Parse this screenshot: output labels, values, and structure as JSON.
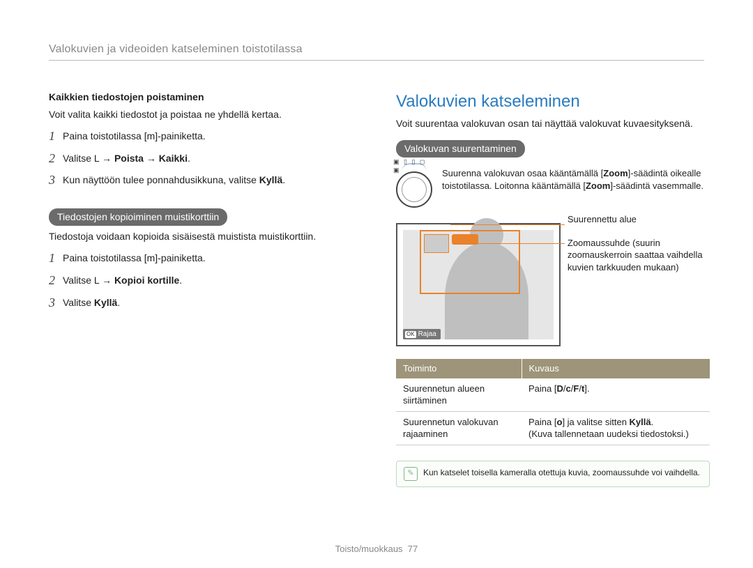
{
  "header": {
    "title": "Valokuvien ja videoiden katseleminen toistotilassa"
  },
  "left": {
    "deleteAll": {
      "title": "Kaikkien tiedostojen poistaminen",
      "desc": "Voit valita kaikki tiedostot ja poistaa ne yhdellä kertaa.",
      "steps": [
        {
          "n": "1",
          "pre": "Paina toistotilassa [",
          "icon": "m",
          "post": "]-painiketta."
        },
        {
          "n": "2",
          "pre": "Valitse ",
          "icon": "L",
          "b1": "Poista",
          "arrow": " → ",
          "b2": "Kaikki",
          "post": "."
        },
        {
          "n": "3",
          "pre": "Kun näyttöön tulee ponnahdusikkuna, valitse ",
          "b1": "Kyllä",
          "post": "."
        }
      ]
    },
    "copy": {
      "pill": "Tiedostojen kopioiminen muistikorttiin",
      "desc": "Tiedostoja voidaan kopioida sisäisestä muistista muistikorttiin.",
      "steps": [
        {
          "n": "1",
          "pre": "Paina toistotilassa [",
          "icon": "m",
          "post": "]-painiketta."
        },
        {
          "n": "2",
          "pre": "Valitse ",
          "icon": "L",
          "arrow": " → ",
          "b1": "Kopioi kortille",
          "post": "."
        },
        {
          "n": "3",
          "pre": "Valitse ",
          "b1": "Kyllä",
          "post": "."
        }
      ]
    }
  },
  "right": {
    "title": "Valokuvien katseleminen",
    "intro": "Voit suurentaa valokuvan osan tai näyttää valokuvat kuvaesityksenä.",
    "zoomPill": "Valokuvan suurentaminen",
    "dialMarks": "▣ ▯ ▯ ◻ ▣",
    "zoomText_a": "Suurenna valokuvan osaa kääntämällä [",
    "zoomText_b": "Zoom",
    "zoomText_c": "]-säädintä oikealle toistotilassa. Loitonna kääntämällä [",
    "zoomText_d": "Zoom",
    "zoomText_e": "]-säädintä vasemmalle.",
    "labelA": "Suurennettu alue",
    "labelB": "Zoomaussuhde (suurin zoomauskerroin saattaa vaihdella kuvien tarkkuuden mukaan)",
    "okLabel": "Rajaa",
    "okGlyph": "OK",
    "table": {
      "headFunc": "Toiminto",
      "headDesc": "Kuvaus",
      "rows": [
        {
          "func": "Suurennetun alueen siirtäminen",
          "desc_a": "Paina [",
          "desc_b": "D",
          "desc_c": "/",
          "desc_d": "c",
          "desc_e": "/",
          "desc_f": "F",
          "desc_g": "/",
          "desc_h": "t",
          "desc_i": "]."
        },
        {
          "func": "Suurennetun valokuvan rajaaminen",
          "desc_a": "Paina [",
          "desc_b": "o",
          "desc_c": "] ja valitse sitten ",
          "desc_d": "Kyllä",
          "desc_e": ".",
          "desc_sub": "(Kuva tallennetaan uudeksi tiedostoksi.)"
        }
      ]
    },
    "note": "Kun katselet toisella kameralla otettuja kuvia, zoomaussuhde voi vaihdella."
  },
  "footer": {
    "section": "Toisto/muokkaus",
    "page": "77"
  }
}
